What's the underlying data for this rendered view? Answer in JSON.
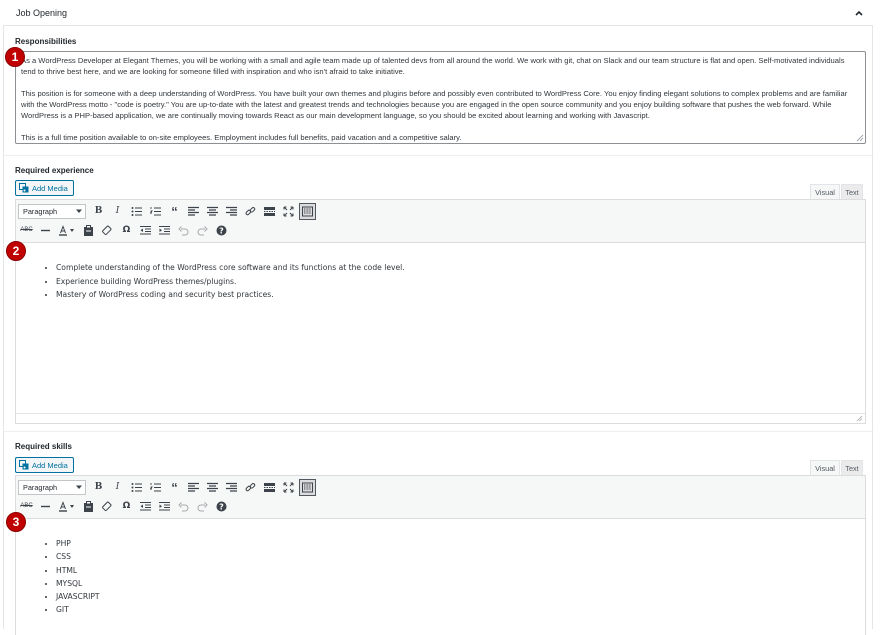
{
  "panel": {
    "title": "Job Opening"
  },
  "responsibilities": {
    "label": "Responsibilities",
    "paragraphs": [
      "As a WordPress Developer at Elegant Themes, you will be working with a small and agile team made up of talented devs from all around the world. We work with git, chat on Slack and our team structure is flat and open. Self-motivated individuals tend to thrive best here, and we are looking for someone filled with inspiration and who isn't afraid to take initiative.",
      "This position is for someone with a deep understanding of WordPress. You have built your own themes and plugins before and possibly even contributed to WordPress Core. You enjoy finding elegant solutions to complex problems and are familiar with the WordPress motto - \"code is poetry.\" You are up-to-date with the latest and greatest trends and technologies because you are engaged in the open source community and you enjoy building software that pushes the web forward. While WordPress is a PHP-based application, we are continually moving towards React as our main development language, so you should be excited about learning and working with Javascript.",
      "This is a full time position available to on-site employees. Employment includes full benefits, paid vacation and a competitive salary."
    ]
  },
  "editor_ui": {
    "add_media": "Add Media",
    "tab_visual": "Visual",
    "tab_text": "Text",
    "format_value": "Paragraph"
  },
  "required_experience": {
    "label": "Required experience",
    "items": [
      "Complete understanding of the WordPress core software and its functions at the code level.",
      "Experience building WordPress themes/plugins.",
      "Mastery of WordPress coding and security best practices."
    ]
  },
  "required_skills": {
    "label": "Required skills",
    "items": [
      "PHP",
      "CSS",
      "HTML",
      "MYSQL",
      "JAVASCRIPT",
      "GIT"
    ]
  },
  "markers": [
    "1",
    "2",
    "3"
  ],
  "colors": {
    "accent": "#0071a1",
    "marker": "#c00000"
  }
}
